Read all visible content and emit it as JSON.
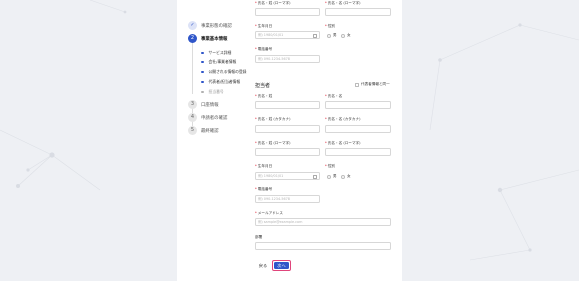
{
  "stepper": {
    "steps": [
      {
        "num": "✓",
        "label": "事業形態の確認",
        "state": "done"
      },
      {
        "num": "2",
        "label": "事業基本情報",
        "state": "active"
      },
      {
        "num": "3",
        "label": "口座情報",
        "state": "todo"
      },
      {
        "num": "4",
        "label": "申請者の確認",
        "state": "todo"
      },
      {
        "num": "5",
        "label": "最終確認",
        "state": "todo"
      }
    ],
    "substeps": [
      {
        "label": "サービス詳細",
        "active": true
      },
      {
        "label": "会社/事業者情報",
        "active": true
      },
      {
        "label": "公開される情報の登録",
        "active": true
      },
      {
        "label": "代表者/担当者情報",
        "active": true
      },
      {
        "label": "担当番号",
        "active": false
      }
    ]
  },
  "representative": {
    "last_name_roman_label": "氏名・姓 (ローマ字)",
    "first_name_roman_label": "氏名・名 (ローマ字)",
    "birthdate_label": "生年月日",
    "birthdate_placeholder": "例) 1980/01/01",
    "gender_label": "性別",
    "male": "男",
    "female": "女",
    "phone_label": "電話番号",
    "phone_placeholder": "例) 090-1234-5678"
  },
  "contact": {
    "section_title": "担当者",
    "same_as_rep_label": "代表者情報と同一",
    "last_name_label": "氏名・姓",
    "first_name_label": "氏名・名",
    "last_name_kana_label": "氏名・姓 (カタカナ)",
    "first_name_kana_label": "氏名・名 (カタカナ)",
    "last_name_roman_label": "氏名・姓 (ローマ字)",
    "first_name_roman_label": "氏名・名 (ローマ字)",
    "birthdate_label": "生年月日",
    "birthdate_placeholder": "例) 1980/01/01",
    "gender_label": "性別",
    "male": "男",
    "female": "女",
    "phone_label": "電話番号",
    "phone_placeholder": "例) 090-1234-5678",
    "email_label": "メールアドレス",
    "email_placeholder": "例) sample@example.com",
    "department_label": "部署"
  },
  "actions": {
    "back_label": "戻る",
    "next_label": "次へ"
  },
  "colors": {
    "accent": "#2f56c9",
    "focus_ring": "#e0457b"
  }
}
